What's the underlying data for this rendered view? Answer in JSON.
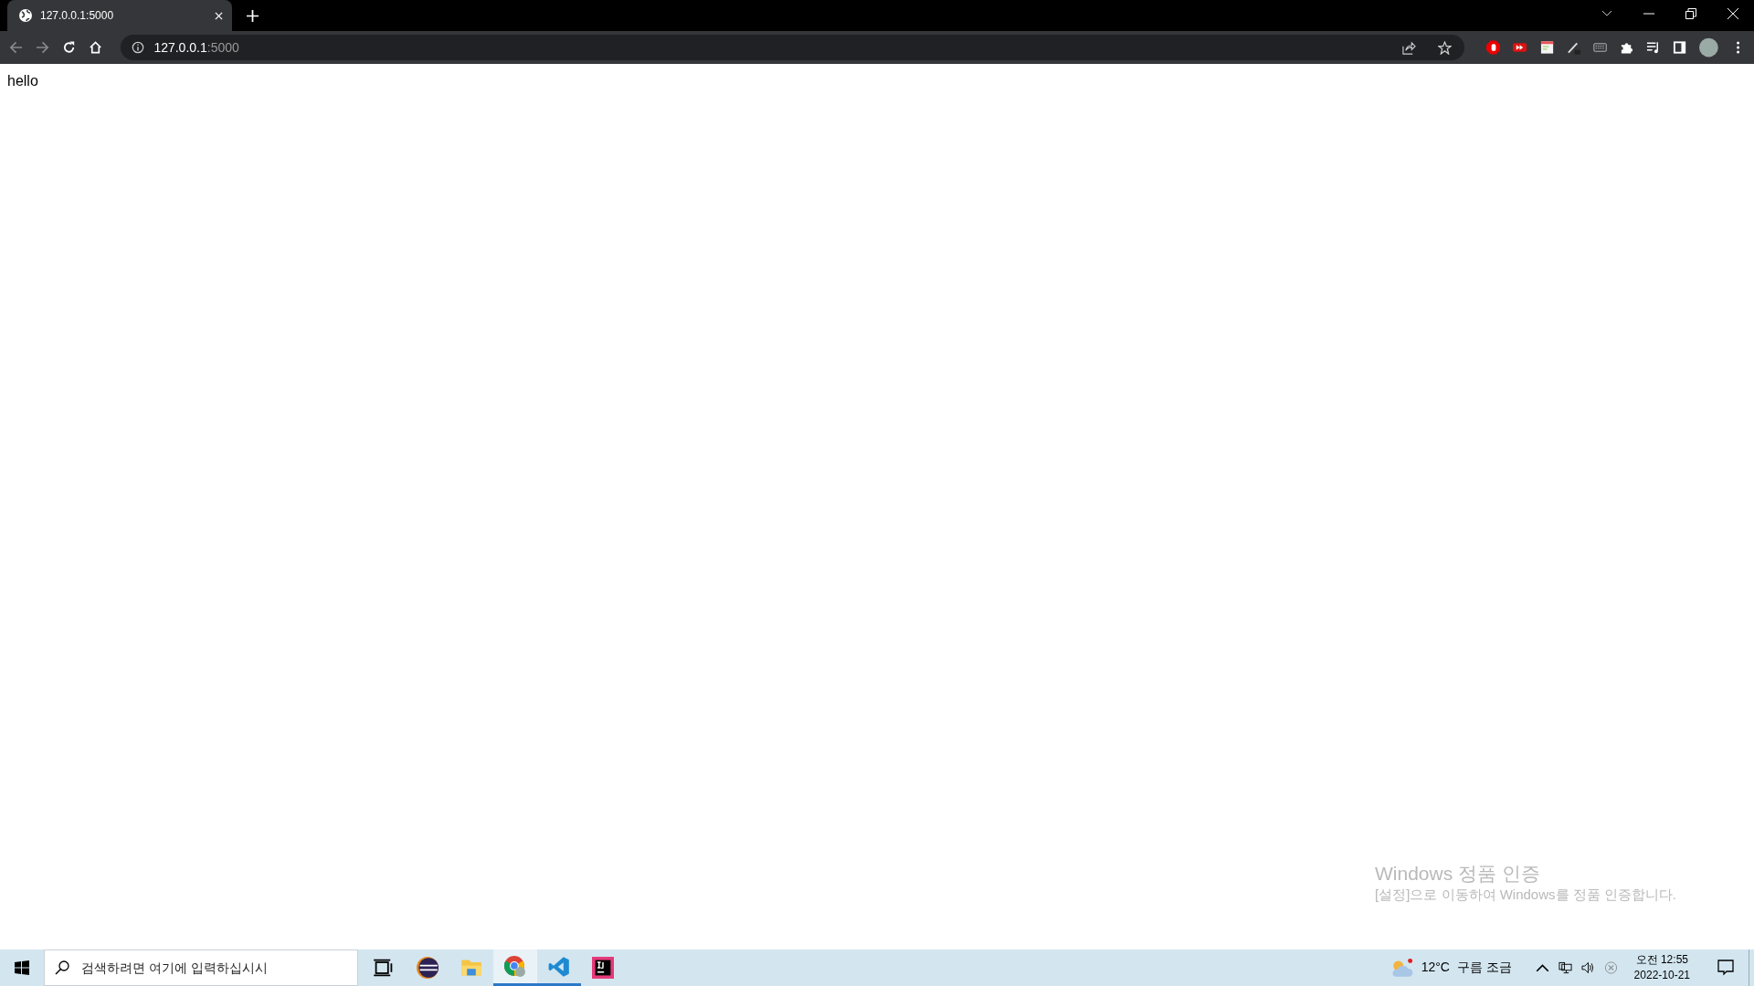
{
  "tabs": [
    {
      "title": "127.0.0.1:5000",
      "selected": true
    }
  ],
  "address_bar": {
    "host": "127.0.0.1",
    "port": ":5000"
  },
  "page": {
    "text": "hello"
  },
  "activation_notice": {
    "title": "Windows 정품 인증",
    "message": "[설정]으로 이동하여 Windows를 정품 인증합니다."
  },
  "taskbar": {
    "search": {
      "placeholder": "검색하려면 여기에 입력하십시시"
    },
    "apps": [
      {
        "kind": "taskview",
        "open": false,
        "selected": false
      },
      {
        "kind": "eclipse",
        "open": false,
        "selected": false
      },
      {
        "kind": "explorer",
        "open": false,
        "selected": false
      },
      {
        "kind": "chrome",
        "open": true,
        "selected": true
      },
      {
        "kind": "vscode",
        "open": true,
        "selected": false
      },
      {
        "kind": "intellij",
        "open": false,
        "selected": false
      }
    ],
    "weather": "12°C  구름 조금",
    "clock": {
      "time": "오전 12:55",
      "date": "2022-10-21"
    }
  }
}
